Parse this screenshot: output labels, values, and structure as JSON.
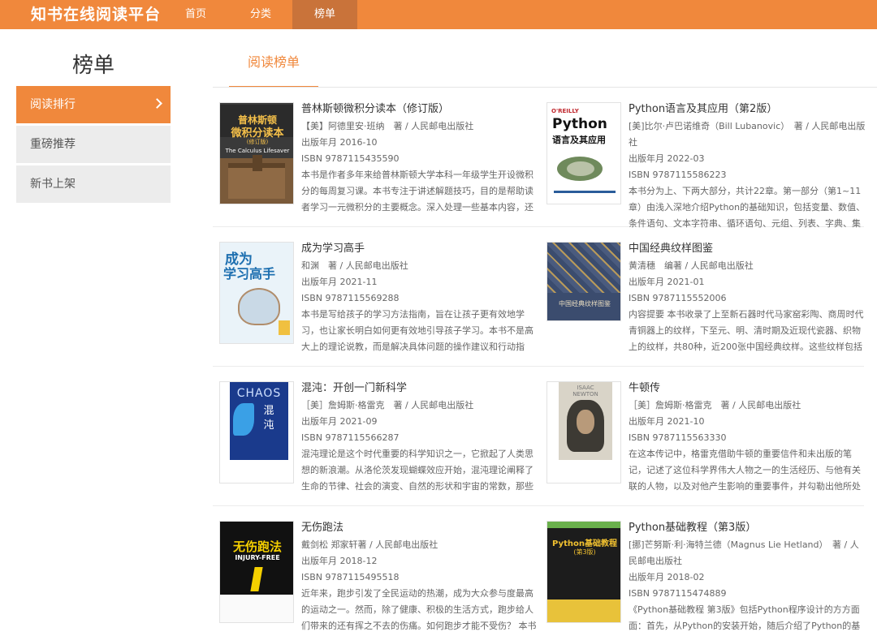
{
  "app": {
    "brand": "知书在线阅读平台",
    "accent": "#f0883c",
    "accent_dark": "#c9733a"
  },
  "nav": {
    "items": [
      {
        "label": "首页"
      },
      {
        "label": "分类"
      },
      {
        "label": "榜单"
      }
    ],
    "active": "榜单"
  },
  "sidebar": {
    "title": "榜单",
    "items": [
      {
        "label": "阅读排行",
        "icon": "chevron-right-icon"
      },
      {
        "label": "重磅推荐"
      },
      {
        "label": "新书上架"
      }
    ]
  },
  "tab": {
    "label": "阅读榜单"
  },
  "books": [
    {
      "title": "普林斯顿微积分读本（修订版）",
      "author": "【美】阿德里安·班纳　著 / 人民邮电出版社",
      "date": "出版年月 2016-10",
      "isbn": "ISBN 9787115435590",
      "desc": "本书是作者多年来给普林斯顿大学本科一年级学生开设微积分的每周复习课。本书专注于讲述解题技巧，目的是帮助读者学习一元微积分的主要概念。深入处理一些基本内容，还",
      "cover_text": [
        "普林斯顿",
        "微积分读本",
        "(修订版)",
        "The Calculus Lifesaver"
      ]
    },
    {
      "title": "Python语言及其应用（第2版）",
      "author": "[美]比尔·卢巴诺维奇（Bill Lubanovic）　著 / 人民邮电出版社",
      "date": "出版年月 2022-03",
      "isbn": "ISBN 9787115586223",
      "desc": "本书分为上、下两大部分，共计22章。第一部分（第1~11章）由浅入深地介绍Python的基础知识，包括变量、数值、条件语句、文本字符串、循环语句、元组、列表、字典、集",
      "cover_text": [
        "O'REILLY",
        "Python",
        "语言及其应用"
      ]
    },
    {
      "title": "成为学习高手",
      "author": "和渊　著 / 人民邮电出版社",
      "date": "出版年月 2021-11",
      "isbn": "ISBN 9787115569288",
      "desc": "本书是写给孩子的学习方法指南，旨在让孩子更有效地学习，也让家长明白如何更有效地引导孩子学习。本书不是高大上的理论说教，而是解决具体问题的操作建议和行动指",
      "cover_text": [
        "成为",
        "学习高手"
      ]
    },
    {
      "title": "中国经典纹样图鉴",
      "author": "黄清穗　编著 / 人民邮电出版社",
      "date": "出版年月 2021-01",
      "isbn": "ISBN 9787115552006",
      "desc": "内容提要 本书收录了上至新石器时代马家窑彩陶、商周时代青铜器上的纹样，下至元、明、清时期及近现代瓷器、织物上的纹样，共80种，近200张中国经典纹样。这些纹样包括兽",
      "cover_text": [
        "中国经典纹样图鉴"
      ]
    },
    {
      "title": "混沌：开创一门新科学",
      "author": "［美］詹姆斯·格雷克　著 / 人民邮电出版社",
      "date": "出版年月 2021-09",
      "isbn": "ISBN 9787115566287",
      "desc": "混沌理论是这个时代重要的科学知识之一，它掀起了人类思想的新浪潮。从洛伦茨发现蝴蝶效应开始，混沌理论阐释了生命的节律、社会的演变、自然的形状和宇宙的常数，那些",
      "cover_text": [
        "CHAOS",
        "混",
        "沌"
      ]
    },
    {
      "title": "牛顿传",
      "author": "［美］詹姆斯·格雷克　著 / 人民邮电出版社",
      "date": "出版年月 2021-10",
      "isbn": "ISBN 9787115563330",
      "desc": "在这本传记中，格雷克借助牛顿的重要信件和未出版的笔记，记述了这位科学界伟大人物之一的生活经历、与他有关联的人物，以及对他产生影响的重要事件，并勾勒出他所处",
      "cover_text": [
        "ISAAC",
        "NEWTON"
      ]
    },
    {
      "title": "无伤跑法",
      "author": "戴剑松 郑家轩著 / 人民邮电出版社",
      "date": "出版年月 2018-12",
      "isbn": "ISBN 9787115495518",
      "desc": "近年来，跑步引发了全民运动的热潮，成为大众参与度最高的运动之一。然而，除了健康、积极的生活方式，跑步给人们带来的还有挥之不去的伤痛。如何跑步才能不受伤？ 本书",
      "cover_text": [
        "无伤跑法",
        "INJURY-FREE"
      ]
    },
    {
      "title": "Python基础教程（第3版）",
      "author": "[挪]芒努斯·利·海特兰德（Magnus Lie Hetland）　著 / 人民邮电出版社",
      "date": "出版年月 2018-02",
      "isbn": "ISBN 9787115474889",
      "desc": "《Python基础教程 第3版》包括Python程序设计的方方面面：首先，从Python的安装开始，随后介绍了Python的基础",
      "cover_text": [
        "Python基础教程",
        "(第3版)"
      ]
    }
  ]
}
